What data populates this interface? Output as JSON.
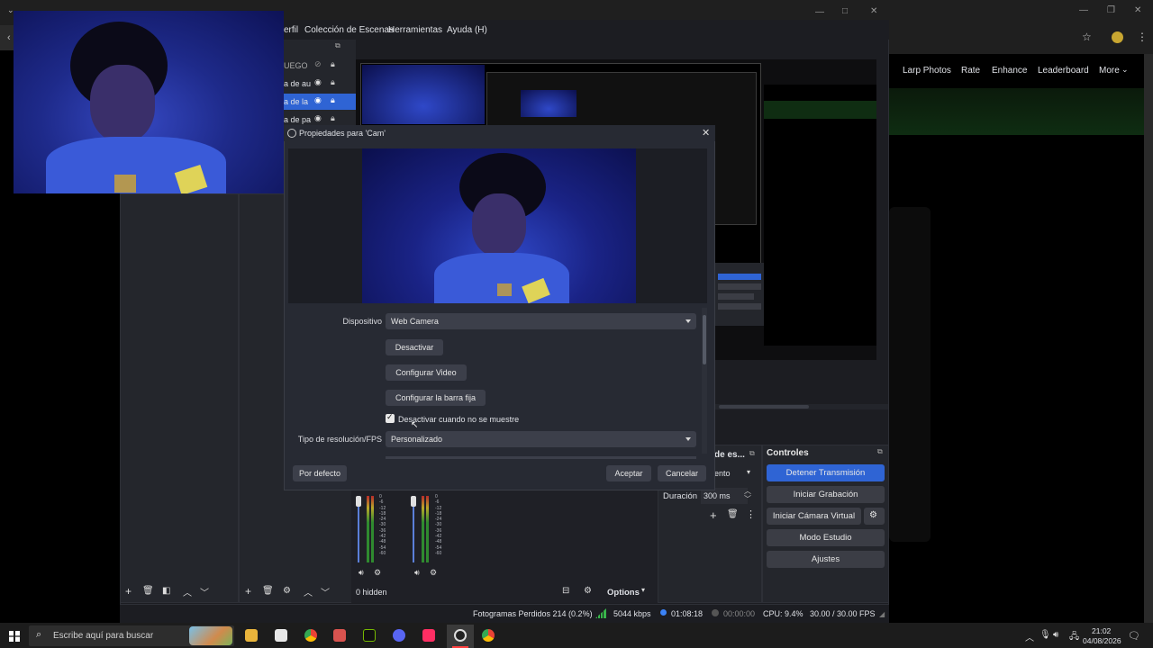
{
  "browser_nav": [
    "Larp Photos",
    "Rate",
    "Enhance",
    "Leaderboard",
    "More"
  ],
  "obs": {
    "menu": [
      "erfil",
      "Colección de Escenas",
      "Herramientas",
      "Ayuda (H)"
    ],
    "sources_partial": [
      "UEGO",
      "a de au",
      "a de la",
      "a de pa"
    ],
    "controls": {
      "title": "Controles",
      "buttons": [
        "Detener Transmisión",
        "Iniciar Grabación",
        "Iniciar Cámara Virtual",
        "Modo Estudio",
        "Ajustes"
      ]
    },
    "transitions": {
      "title": "de es...",
      "selected": "ento",
      "duration_label": "Duración",
      "duration_value": "300 ms"
    },
    "hidden_label": "0 hidden",
    "options_label": "Options",
    "meter_scale": [
      "0",
      "-6",
      "-12",
      "-18",
      "-24",
      "-30",
      "-36",
      "-42",
      "-48",
      "-54",
      "-60"
    ],
    "status": {
      "dropped": "Fotogramas Perdidos 214 (0.2%)",
      "bitrate": "5044 kbps",
      "stream_time": "01:08:18",
      "rec_time": "00:00:00",
      "cpu": "CPU: 9.4%",
      "fps": "30.00 / 30.00 FPS"
    }
  },
  "dialog": {
    "title": "Propiedades para 'Cam'",
    "device_label": "Dispositivo",
    "device_value": "Web Camera",
    "deactivate_button": "Desactivar",
    "configure_video_button": "Configurar Video",
    "configure_crossbar_button": "Configurar la barra fija",
    "checkbox_label": "Desactivar cuando no se muestre",
    "checkbox_checked": true,
    "resolution_label": "Tipo de resolución/FPS",
    "resolution_value": "Personalizado",
    "defaults_button": "Por defecto",
    "ok_button": "Aceptar",
    "cancel_button": "Cancelar"
  },
  "taskbar": {
    "search_placeholder": "Escribe aquí para buscar",
    "time": "21:02",
    "date": "04/08/2026"
  },
  "colors": {
    "accent": "#2f64d4",
    "obs_bg": "#1c1d22",
    "dialog_bg": "#272a33"
  }
}
